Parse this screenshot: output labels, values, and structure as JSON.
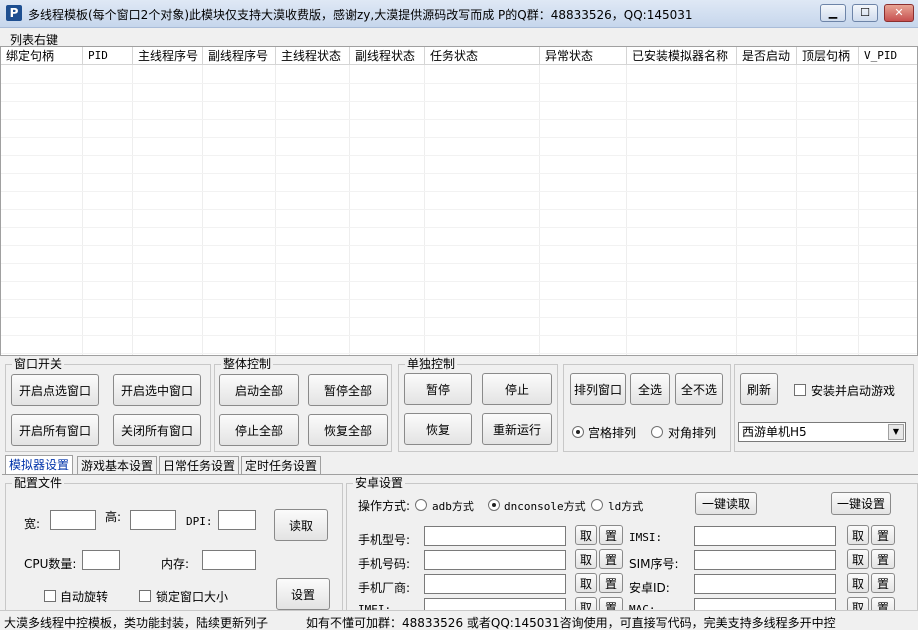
{
  "window": {
    "title": "多线程模板(每个窗口2个对象)此模块仅支持大漠收费版，感谢zy,大漠提供源码改写而成 P的Q群：48833526，QQ:145031",
    "icon_letter": "P",
    "min_glyph": "▁",
    "max_glyph": "☐",
    "close_glyph": "✕"
  },
  "menu": {
    "items": [
      "列表右键"
    ]
  },
  "list": {
    "columns": [
      "绑定句柄",
      "PID",
      "主线程序号",
      "副线程序号",
      "主线程状态",
      "副线程状态",
      "任务状态",
      "异常状态",
      "已安装模拟器名称",
      "是否启动",
      "顶层句柄",
      "V_PID"
    ]
  },
  "groups": {
    "window_switch": {
      "label": "窗口开关",
      "open_selected_points": "开启点选窗口",
      "open_selected": "开启选中窗口",
      "open_all": "开启所有窗口",
      "close_all": "关闭所有窗口"
    },
    "global_control": {
      "label": "整体控制",
      "start_all": "启动全部",
      "pause_all": "暂停全部",
      "stop_all": "停止全部",
      "resume_all": "恢复全部"
    },
    "single_control": {
      "label": "单独控制",
      "pause": "暂停",
      "stop": "停止",
      "resume": "恢复",
      "rerun": "重新运行"
    },
    "arrange": {
      "arrange": "排列窗口",
      "select_all": "全选",
      "select_none": "全不选",
      "grid": "宫格排列",
      "diagonal": "对角排列",
      "grid_selected": true
    },
    "misc": {
      "refresh": "刷新",
      "install_launch": "安装并启动游戏",
      "game_selected": "西游单机H5",
      "dropdown_glyph": "▼"
    }
  },
  "tabs": [
    "模拟器设置",
    "游戏基本设置",
    "日常任务设置",
    "定时任务设置"
  ],
  "config": {
    "label": "配置文件",
    "width_label": "宽:",
    "height_label": "高:",
    "dpi_label": "DPI:",
    "cpu_label": "CPU数量:",
    "memory_label": "内存:",
    "read_button": "读取",
    "set_button": "设置",
    "auto_rotate": "自动旋转",
    "lock_size": "锁定窗口大小"
  },
  "android": {
    "label": "安卓设置",
    "mode_label": "操作方式:",
    "mode_adb": "adb方式",
    "mode_dnconsole": "dnconsole方式",
    "mode_ld": "ld方式",
    "mode_selected": "dnconsole",
    "read_all": "一键读取",
    "set_all": "一键设置",
    "take": "取",
    "set": "置",
    "fields_left": [
      "手机型号:",
      "手机号码:",
      "手机厂商:",
      "IMEI:"
    ],
    "fields_right": [
      "IMSI:",
      "SIM序号:",
      "安卓ID:",
      "MAC:"
    ]
  },
  "status": {
    "left": "大漠多线程中控模板，类功能封装，陆续更新列子",
    "right": "如有不懂可加群：48833526 或者QQ:145031咨询使用，可直接写代码，完美支持多线程多开中控"
  }
}
